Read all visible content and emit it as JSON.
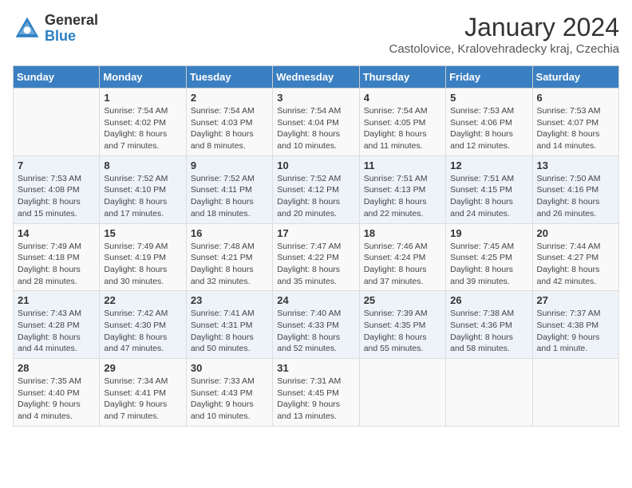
{
  "header": {
    "logo_general": "General",
    "logo_blue": "Blue",
    "month_year": "January 2024",
    "location": "Castolovice, Kralovehradecky kraj, Czechia"
  },
  "weekdays": [
    "Sunday",
    "Monday",
    "Tuesday",
    "Wednesday",
    "Thursday",
    "Friday",
    "Saturday"
  ],
  "weeks": [
    [
      {
        "day": "",
        "info": ""
      },
      {
        "day": "1",
        "info": "Sunrise: 7:54 AM\nSunset: 4:02 PM\nDaylight: 8 hours\nand 7 minutes."
      },
      {
        "day": "2",
        "info": "Sunrise: 7:54 AM\nSunset: 4:03 PM\nDaylight: 8 hours\nand 8 minutes."
      },
      {
        "day": "3",
        "info": "Sunrise: 7:54 AM\nSunset: 4:04 PM\nDaylight: 8 hours\nand 10 minutes."
      },
      {
        "day": "4",
        "info": "Sunrise: 7:54 AM\nSunset: 4:05 PM\nDaylight: 8 hours\nand 11 minutes."
      },
      {
        "day": "5",
        "info": "Sunrise: 7:53 AM\nSunset: 4:06 PM\nDaylight: 8 hours\nand 12 minutes."
      },
      {
        "day": "6",
        "info": "Sunrise: 7:53 AM\nSunset: 4:07 PM\nDaylight: 8 hours\nand 14 minutes."
      }
    ],
    [
      {
        "day": "7",
        "info": "Sunrise: 7:53 AM\nSunset: 4:08 PM\nDaylight: 8 hours\nand 15 minutes."
      },
      {
        "day": "8",
        "info": "Sunrise: 7:52 AM\nSunset: 4:10 PM\nDaylight: 8 hours\nand 17 minutes."
      },
      {
        "day": "9",
        "info": "Sunrise: 7:52 AM\nSunset: 4:11 PM\nDaylight: 8 hours\nand 18 minutes."
      },
      {
        "day": "10",
        "info": "Sunrise: 7:52 AM\nSunset: 4:12 PM\nDaylight: 8 hours\nand 20 minutes."
      },
      {
        "day": "11",
        "info": "Sunrise: 7:51 AM\nSunset: 4:13 PM\nDaylight: 8 hours\nand 22 minutes."
      },
      {
        "day": "12",
        "info": "Sunrise: 7:51 AM\nSunset: 4:15 PM\nDaylight: 8 hours\nand 24 minutes."
      },
      {
        "day": "13",
        "info": "Sunrise: 7:50 AM\nSunset: 4:16 PM\nDaylight: 8 hours\nand 26 minutes."
      }
    ],
    [
      {
        "day": "14",
        "info": "Sunrise: 7:49 AM\nSunset: 4:18 PM\nDaylight: 8 hours\nand 28 minutes."
      },
      {
        "day": "15",
        "info": "Sunrise: 7:49 AM\nSunset: 4:19 PM\nDaylight: 8 hours\nand 30 minutes."
      },
      {
        "day": "16",
        "info": "Sunrise: 7:48 AM\nSunset: 4:21 PM\nDaylight: 8 hours\nand 32 minutes."
      },
      {
        "day": "17",
        "info": "Sunrise: 7:47 AM\nSunset: 4:22 PM\nDaylight: 8 hours\nand 35 minutes."
      },
      {
        "day": "18",
        "info": "Sunrise: 7:46 AM\nSunset: 4:24 PM\nDaylight: 8 hours\nand 37 minutes."
      },
      {
        "day": "19",
        "info": "Sunrise: 7:45 AM\nSunset: 4:25 PM\nDaylight: 8 hours\nand 39 minutes."
      },
      {
        "day": "20",
        "info": "Sunrise: 7:44 AM\nSunset: 4:27 PM\nDaylight: 8 hours\nand 42 minutes."
      }
    ],
    [
      {
        "day": "21",
        "info": "Sunrise: 7:43 AM\nSunset: 4:28 PM\nDaylight: 8 hours\nand 44 minutes."
      },
      {
        "day": "22",
        "info": "Sunrise: 7:42 AM\nSunset: 4:30 PM\nDaylight: 8 hours\nand 47 minutes."
      },
      {
        "day": "23",
        "info": "Sunrise: 7:41 AM\nSunset: 4:31 PM\nDaylight: 8 hours\nand 50 minutes."
      },
      {
        "day": "24",
        "info": "Sunrise: 7:40 AM\nSunset: 4:33 PM\nDaylight: 8 hours\nand 52 minutes."
      },
      {
        "day": "25",
        "info": "Sunrise: 7:39 AM\nSunset: 4:35 PM\nDaylight: 8 hours\nand 55 minutes."
      },
      {
        "day": "26",
        "info": "Sunrise: 7:38 AM\nSunset: 4:36 PM\nDaylight: 8 hours\nand 58 minutes."
      },
      {
        "day": "27",
        "info": "Sunrise: 7:37 AM\nSunset: 4:38 PM\nDaylight: 9 hours\nand 1 minute."
      }
    ],
    [
      {
        "day": "28",
        "info": "Sunrise: 7:35 AM\nSunset: 4:40 PM\nDaylight: 9 hours\nand 4 minutes."
      },
      {
        "day": "29",
        "info": "Sunrise: 7:34 AM\nSunset: 4:41 PM\nDaylight: 9 hours\nand 7 minutes."
      },
      {
        "day": "30",
        "info": "Sunrise: 7:33 AM\nSunset: 4:43 PM\nDaylight: 9 hours\nand 10 minutes."
      },
      {
        "day": "31",
        "info": "Sunrise: 7:31 AM\nSunset: 4:45 PM\nDaylight: 9 hours\nand 13 minutes."
      },
      {
        "day": "",
        "info": ""
      },
      {
        "day": "",
        "info": ""
      },
      {
        "day": "",
        "info": ""
      }
    ]
  ]
}
